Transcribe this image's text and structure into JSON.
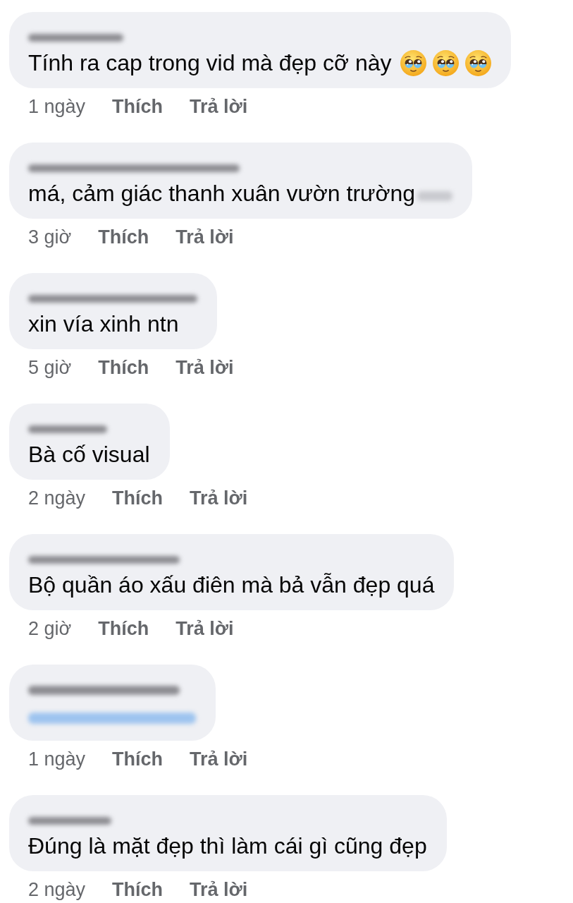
{
  "comments": [
    {
      "author_blurred": true,
      "kind": "text",
      "text": "Tính ra cap trong vid mà đẹp cỡ này",
      "emojis": [
        {
          "kind": "teary-face"
        },
        {
          "kind": "teary-face"
        },
        {
          "kind": "teary-face"
        }
      ],
      "blurred_tail": false,
      "time": "1 ngày",
      "like": "Thích",
      "reply": "Trả lời"
    },
    {
      "author_blurred": true,
      "kind": "text",
      "text": "má, cảm giác thanh xuân vườn trường",
      "blurred_tail": true,
      "time": "3 giờ",
      "like": "Thích",
      "reply": "Trả lời"
    },
    {
      "author_blurred": true,
      "kind": "text",
      "text": "xin vía xinh ntn",
      "blurred_tail": false,
      "time": "5 giờ",
      "like": "Thích",
      "reply": "Trả lời"
    },
    {
      "author_blurred": true,
      "kind": "text",
      "text": "Bà cố visual",
      "blurred_tail": false,
      "time": "2 ngày",
      "like": "Thích",
      "reply": "Trả lời"
    },
    {
      "author_blurred": true,
      "kind": "text",
      "text": "Bộ quần áo xấu điên mà bả vẫn đẹp quá",
      "blurred_tail": false,
      "time": "2 giờ",
      "like": "Thích",
      "reply": "Trả lời"
    },
    {
      "author_blurred": true,
      "kind": "blurred-mention",
      "blurred_tail": false,
      "time": "1 ngày",
      "like": "Thích",
      "reply": "Trả lời"
    },
    {
      "author_blurred": true,
      "kind": "text",
      "text": "Đúng là mặt đẹp thì làm cái gì cũng đẹp",
      "blurred_tail": false,
      "time": "2 ngày",
      "like": "Thích",
      "reply": "Trả lời"
    }
  ]
}
